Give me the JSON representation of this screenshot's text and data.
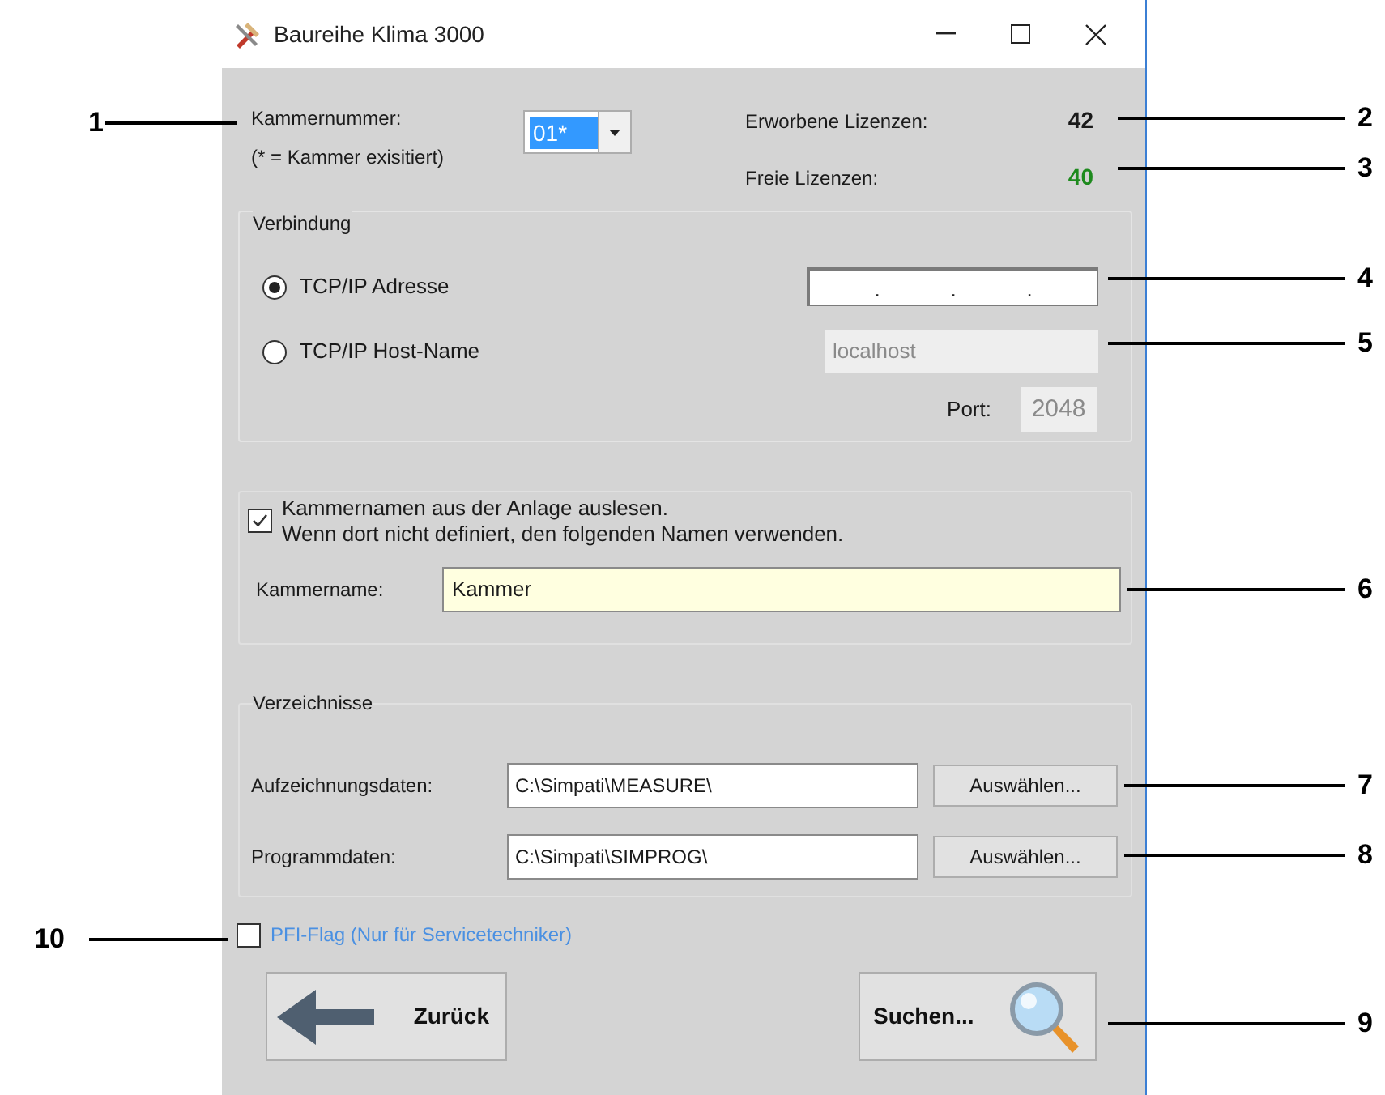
{
  "window": {
    "title": "Baureihe Klima 3000"
  },
  "chamber": {
    "label": "Kammernummer:",
    "hint": "(* = Kammer exisitiert)",
    "value": "01*"
  },
  "licenses": [
    {
      "label": "Erworbene Lizenzen:",
      "value": "42",
      "color": "#1a1a1a"
    },
    {
      "label": "Freie Lizenzen:",
      "value": "40",
      "color": "#1e8a1e"
    }
  ],
  "connection": {
    "title": "Verbindung",
    "options": [
      {
        "label": "TCP/IP Adresse",
        "selected": true
      },
      {
        "label": "TCP/IP Host-Name",
        "selected": false
      }
    ],
    "ip_address": {
      "separators": [
        ".",
        ".",
        "."
      ],
      "disabled": false
    },
    "host_name": {
      "value": "localhost",
      "disabled": true
    },
    "port": {
      "label": "Port:",
      "value": "2048",
      "disabled": true
    }
  },
  "name_group": {
    "checkbox": {
      "lines": [
        "Kammernamen aus der Anlage auslesen.",
        "Wenn dort nicht definiert, den folgenden Namen verwenden."
      ],
      "checked": true
    },
    "name_label": "Kammername:",
    "name_value": "Kammer"
  },
  "directories": {
    "title": "Verzeichnisse",
    "rows": [
      {
        "label": "Aufzeichnungsdaten:",
        "value": "C:\\Simpati\\MEASURE\\",
        "button": "Auswählen..."
      },
      {
        "label": "Programmdaten:",
        "value": "C:\\Simpati\\SIMPROG\\",
        "button": "Auswählen..."
      }
    ]
  },
  "pfi_flag": {
    "label": "PFI-Flag (Nur für Servicetechniker)",
    "checked": false
  },
  "buttons": [
    {
      "label": "Zurück",
      "kind": "back"
    },
    {
      "label": "Suchen...",
      "kind": "search"
    }
  ],
  "callouts": [
    "1",
    "2",
    "3",
    "4",
    "5",
    "6",
    "7",
    "8",
    "9",
    "10"
  ]
}
